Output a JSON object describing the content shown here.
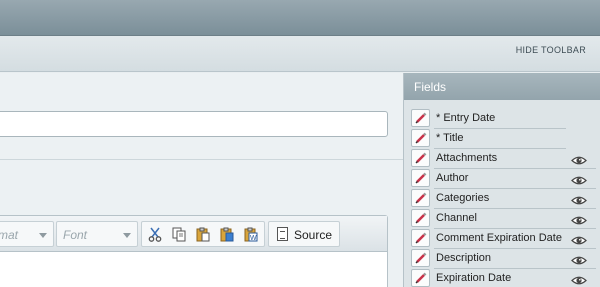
{
  "header": {
    "hide_toolbar_label": "HIDE TOOLBAR"
  },
  "editor": {
    "format_dropdown": "mat",
    "font_dropdown": "Font",
    "toolbar_buttons": [
      "cut-icon",
      "copy-icon",
      "paste-icon",
      "paste-text-icon",
      "paste-word-icon"
    ],
    "source_label": "Source"
  },
  "fields_panel": {
    "title": "Fields",
    "fields": [
      {
        "label": "* Entry Date",
        "eye": false
      },
      {
        "label": "* Title",
        "eye": false
      },
      {
        "label": "Attachments",
        "eye": true
      },
      {
        "label": "Author",
        "eye": true
      },
      {
        "label": "Categories",
        "eye": true
      },
      {
        "label": "Channel",
        "eye": true
      },
      {
        "label": "Comment Expiration Date",
        "eye": true
      },
      {
        "label": "Description",
        "eye": true
      },
      {
        "label": "Expiration Date",
        "eye": true
      }
    ]
  },
  "colors": {
    "pencil": "#c8334a",
    "header_bar": "#7b8f99"
  }
}
